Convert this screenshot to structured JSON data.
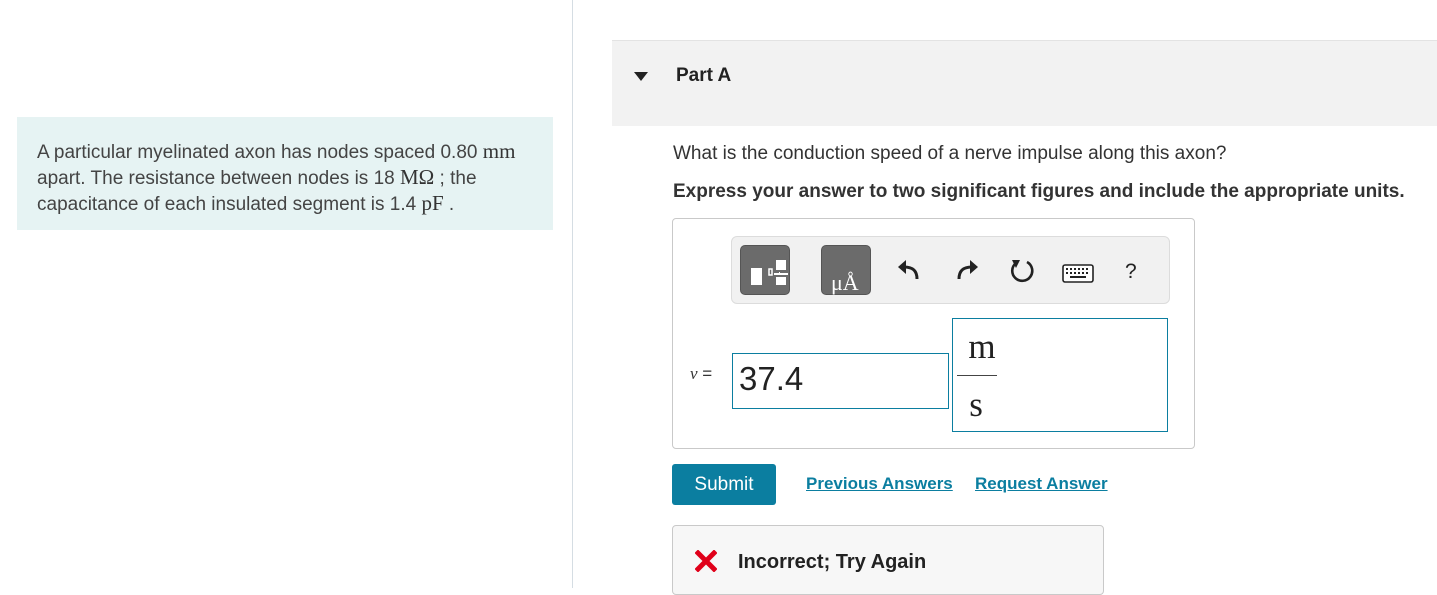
{
  "problem": {
    "text_1": "A particular myelinated axon has nodes spaced 0.80 ",
    "unit_1": "mm",
    "text_2": " apart. The resistance between nodes is 18 ",
    "unit_2": "MΩ",
    "text_3": " ; the capacitance of each insulated segment is 1.4 ",
    "unit_3": "pF",
    "text_4": " ."
  },
  "part": {
    "title": "Part A"
  },
  "question": "What is the conduction speed of a nerve impulse along this axon?",
  "instruction": "Express your answer to two significant figures and include the appropriate units.",
  "toolbar": {
    "units_button_label": "μÅ",
    "help_label": "?"
  },
  "answer": {
    "variable": "v",
    "equals": " =",
    "value": "37.4",
    "unit_numerator": "m",
    "unit_denominator": "s"
  },
  "actions": {
    "submit_label": "Submit",
    "previous_answers_label": "Previous Answers",
    "request_answer_label": "Request Answer"
  },
  "feedback": {
    "status_text": "Incorrect; Try Again",
    "status_color": "#e0001a"
  },
  "colors": {
    "accent": "#0b7ea0",
    "problem_background": "#e6f3f3"
  }
}
